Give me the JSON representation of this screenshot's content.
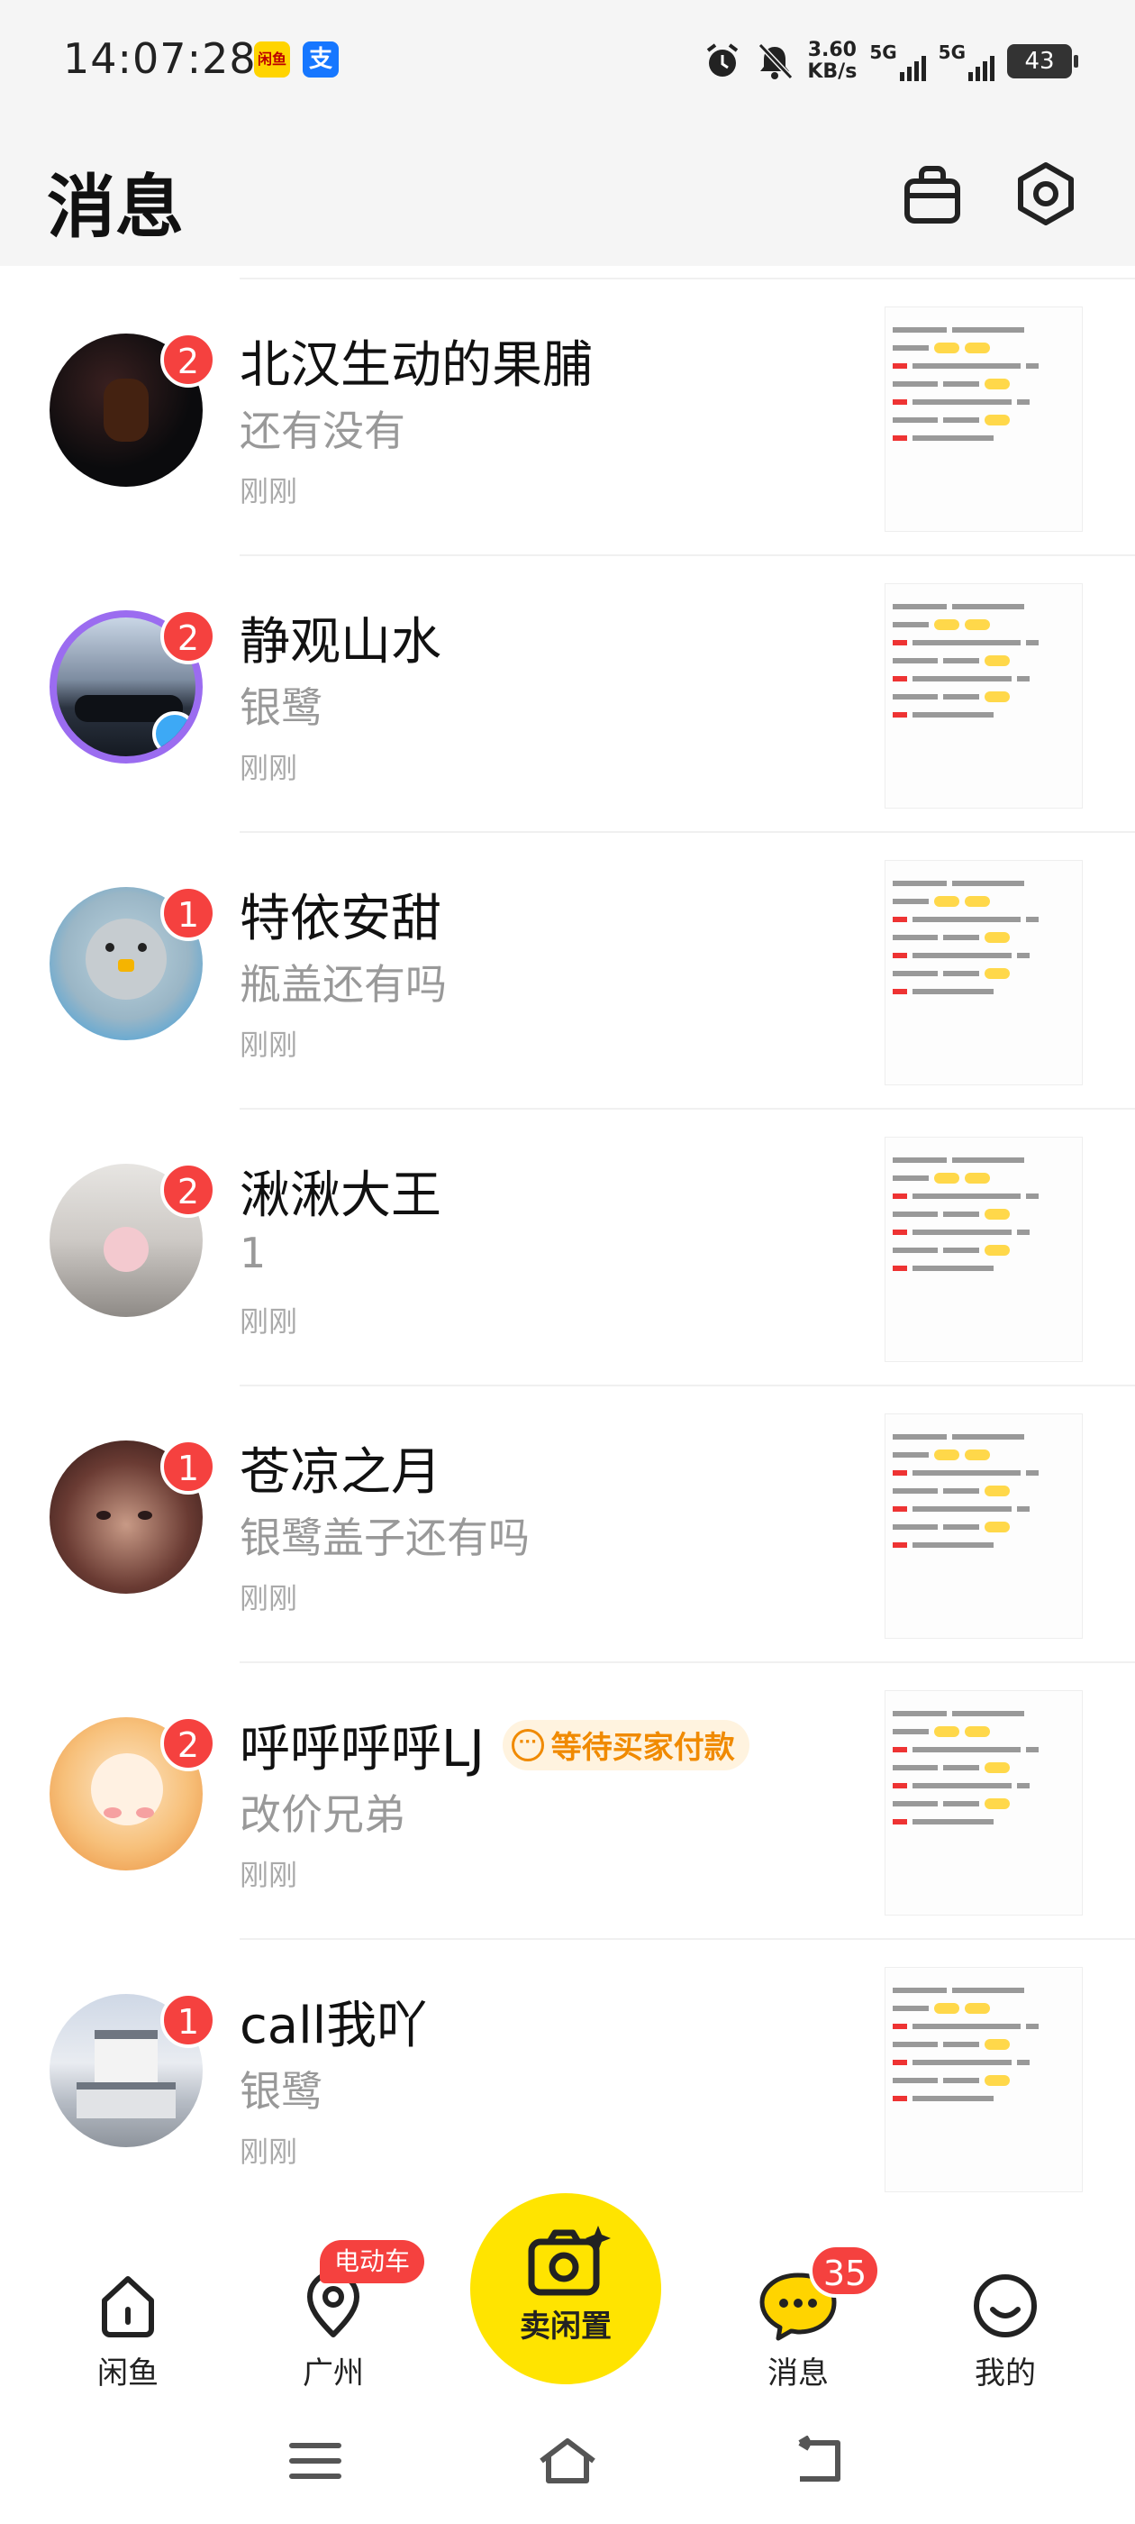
{
  "status_bar": {
    "time": "14:07:28",
    "app_icons": [
      "xianyu-app-icon",
      "alipay-icon"
    ],
    "alipay_glyph": "支",
    "xianyu_glyph": "闲鱼",
    "net_speed": "3.60",
    "net_unit": "KB/s",
    "sim1": "5G",
    "sim2": "5G",
    "battery": "43"
  },
  "header": {
    "title": "消息",
    "icons": [
      "bag-icon",
      "settings-icon"
    ]
  },
  "conversations": [
    {
      "name": "北汉生动的果脯",
      "message": "还有没有",
      "time": "刚刚",
      "unread": "2"
    },
    {
      "name": "静观山水",
      "message": "银鹭",
      "time": "刚刚",
      "unread": "2"
    },
    {
      "name": "特依安甜",
      "message": "瓶盖还有吗",
      "time": "刚刚",
      "unread": "1"
    },
    {
      "name": "湫湫大王",
      "message": "1",
      "time": "刚刚",
      "unread": "2"
    },
    {
      "name": "苍凉之月",
      "message": "银鹭盖子还有吗",
      "time": "刚刚",
      "unread": "1"
    },
    {
      "name": "呼呼呼呼LJ",
      "message": "改价兄弟",
      "time": "刚刚",
      "unread": "2",
      "tag": "等待买家付款",
      "tag_glyph": "···"
    },
    {
      "name": "call我吖",
      "message": "银鹭",
      "time": "刚刚",
      "unread": "1"
    }
  ],
  "bottom_nav": {
    "items": [
      {
        "label": "闲鱼",
        "icon": "home-icon"
      },
      {
        "label": "广州",
        "icon": "location-icon",
        "pill": "电动车"
      },
      {
        "label": "卖闲置",
        "icon": "camera-icon"
      },
      {
        "label": "消息",
        "icon": "chat-icon",
        "count": "35"
      },
      {
        "label": "我的",
        "icon": "smile-icon"
      }
    ]
  },
  "colors": {
    "accent": "#ffe400",
    "badge": "#f5413f",
    "tag_text": "#f08a00",
    "tag_bg": "#fff3df"
  }
}
